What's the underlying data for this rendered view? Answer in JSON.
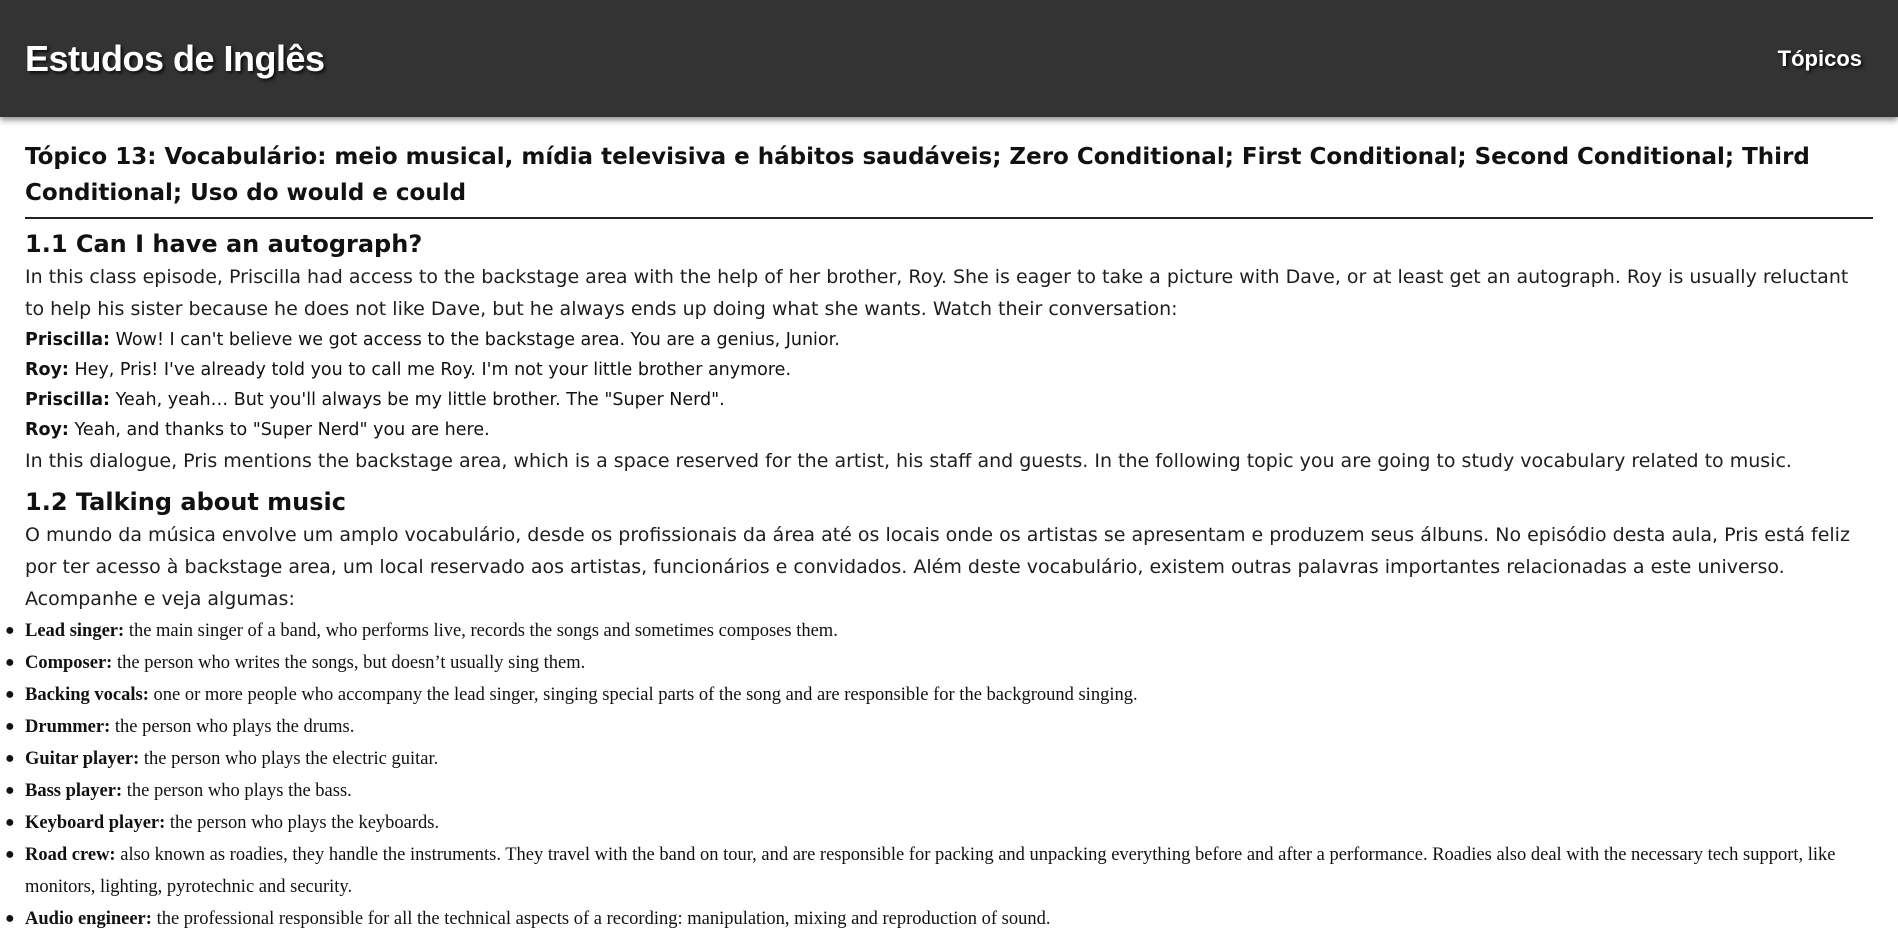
{
  "header": {
    "brand": "Estudos de Inglês",
    "nav_topics": "Tópicos"
  },
  "topic": {
    "title": "Tópico 13: Vocabulário: meio musical, mídia televisiva e hábitos saudáveis; Zero Conditional; First Conditional; Second Conditional; Third Conditional; Uso do would e could"
  },
  "section1": {
    "heading": "1.1 Can I have an autograph?",
    "intro": "In this class episode, Priscilla had access to the backstage area with the help of her brother, Roy. She is eager to take a picture with Dave, or at least get an autograph. Roy is usually reluctant to help his sister because he does not like Dave, but he always ends up doing what she wants. Watch their conversation:",
    "dialogue": [
      {
        "speaker": "Priscilla:",
        "line": "Wow! I can't believe we got access to the backstage area. You are a genius, Junior."
      },
      {
        "speaker": "Roy:",
        "line": "Hey, Pris! I've already told you to call me Roy. I'm not your little brother anymore."
      },
      {
        "speaker": "Priscilla:",
        "line": "Yeah, yeah… But you'll always be my little brother. The \"Super Nerd\"."
      },
      {
        "speaker": "Roy:",
        "line": "Yeah, and thanks to \"Super Nerd\" you are here."
      }
    ],
    "outro": "In this dialogue, Pris mentions the backstage area, which is a space reserved for the artist, his staff and guests. In the following topic you are going to study vocabulary related to music."
  },
  "section2": {
    "heading": "1.2 Talking about music",
    "intro": "O mundo da música envolve um amplo vocabulário, desde os profissionais da área até os locais onde os artistas se apresentam e produzem seus álbuns. No episódio desta aula, Pris está feliz por ter acesso à backstage area, um local reservado aos artistas, funcionários e convidados. Além deste vocabulário, existem outras palavras importantes relacionadas a este universo. Acompanhe e veja algumas:",
    "vocab": [
      {
        "term": "Lead singer:",
        "def": "the main singer of a band, who performs live, records the songs and sometimes composes them."
      },
      {
        "term": "Composer:",
        "def": "the person who writes the songs, but doesn’t usually sing them."
      },
      {
        "term": "Backing vocals:",
        "def": "one or more people who accompany the lead singer, singing special parts of the song and are responsible for the background singing."
      },
      {
        "term": "Drummer:",
        "def": "the person who plays the drums."
      },
      {
        "term": "Guitar player:",
        "def": "the person who plays the electric guitar."
      },
      {
        "term": "Bass player:",
        "def": "the person who plays the bass."
      },
      {
        "term": "Keyboard player:",
        "def": "the person who plays the keyboards."
      },
      {
        "term": "Road crew:",
        "def": "also known as roadies, they handle the instruments. They travel with the band on tour, and are responsible for packing and unpacking everything before and after a performance. Roadies also deal with the necessary tech support, like monitors, lighting, pyrotechnic and security."
      },
      {
        "term": "Audio engineer:",
        "def": "the professional responsible for all the technical aspects of a recording: manipulation, mixing and reproduction of sound."
      }
    ]
  }
}
